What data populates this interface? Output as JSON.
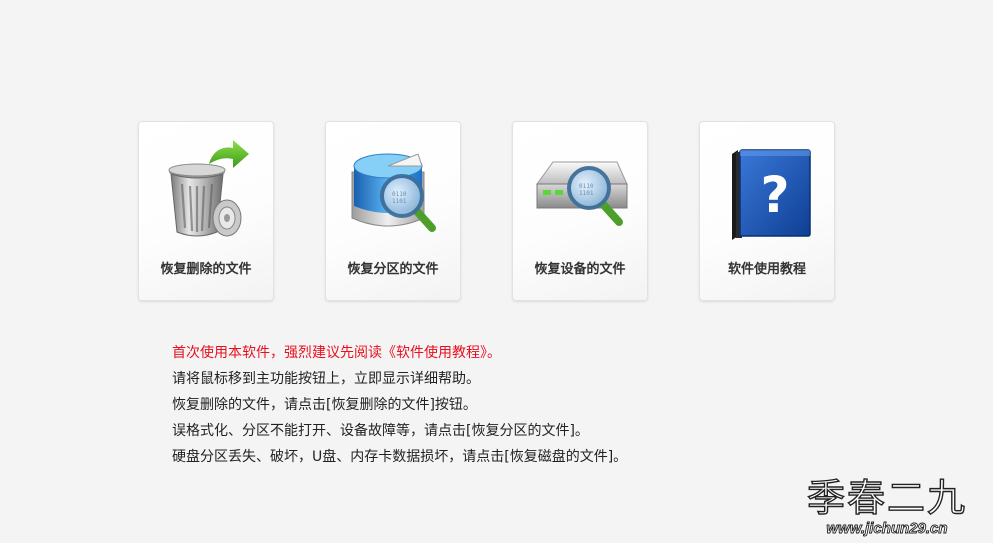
{
  "cards": [
    {
      "label": "恢复删除的文件",
      "icon": "recycle-bin-restore-icon"
    },
    {
      "label": "恢复分区的文件",
      "icon": "partition-magnifier-icon"
    },
    {
      "label": "恢复设备的文件",
      "icon": "device-magnifier-icon"
    },
    {
      "label": "软件使用教程",
      "icon": "help-book-icon"
    }
  ],
  "tips": [
    "首次使用本软件，强烈建议先阅读《软件使用教程》。",
    "请将鼠标移到主功能按钮上，立即显示详细帮助。",
    "恢复删除的文件，请点击[恢复删除的文件]按钮。",
    "误格式化、分区不能打开、设备故障等，请点击[恢复分区的文件]。",
    "硬盘分区丢失、破坏，U盘、内存卡数据损坏，请点击[恢复磁盘的文件]。"
  ],
  "watermark": {
    "title": "季春二九",
    "url": "www.jichun29.cn"
  },
  "colors": {
    "background": "#f4f4f4",
    "highlight_text": "#e8101e",
    "body_text": "#222222",
    "card_label": "#333333"
  }
}
